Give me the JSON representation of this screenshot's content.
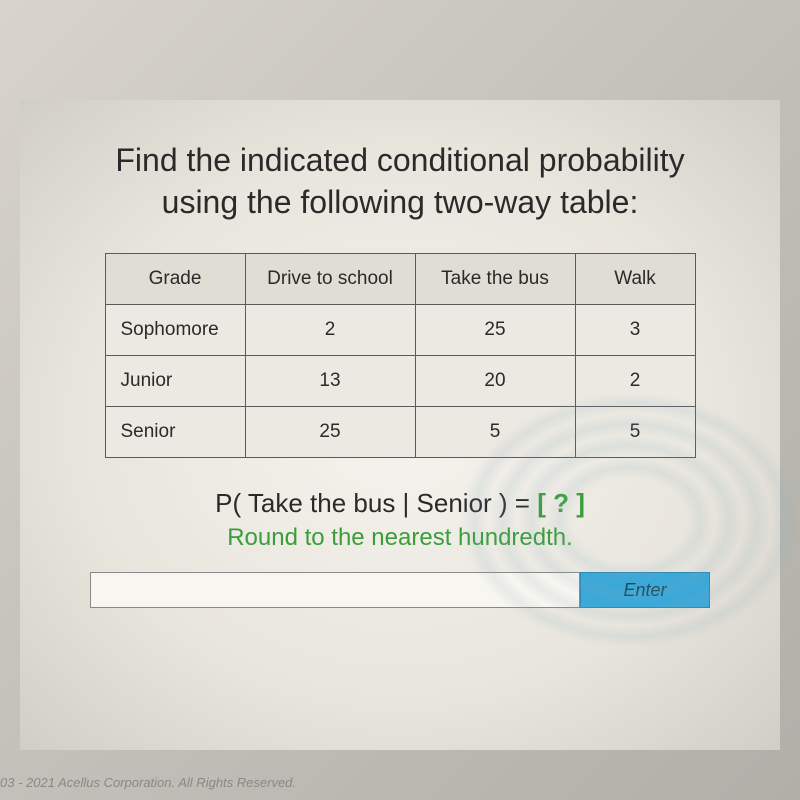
{
  "title_line1": "Find the indicated conditional probability",
  "title_line2": "using the following two-way table:",
  "table": {
    "headers": [
      "Grade",
      "Drive to school",
      "Take the bus",
      "Walk"
    ],
    "rows": [
      {
        "grade": "Sophomore",
        "drive": "2",
        "bus": "25",
        "walk": "3"
      },
      {
        "grade": "Junior",
        "drive": "13",
        "bus": "20",
        "walk": "2"
      },
      {
        "grade": "Senior",
        "drive": "25",
        "bus": "5",
        "walk": "5"
      }
    ]
  },
  "question_prefix": "P( Take the bus | Senior ) = ",
  "question_placeholder": "[ ? ]",
  "instruction": "Round to the nearest hundredth.",
  "enter_label": "Enter",
  "footer": "03 - 2021 Acellus Corporation. All Rights Reserved.",
  "chart_data": {
    "type": "table",
    "title": "Conditional Probability Two-Way Table",
    "columns": [
      "Grade",
      "Drive to school",
      "Take the bus",
      "Walk"
    ],
    "rows": [
      [
        "Sophomore",
        2,
        25,
        3
      ],
      [
        "Junior",
        13,
        20,
        2
      ],
      [
        "Senior",
        25,
        5,
        5
      ]
    ]
  }
}
